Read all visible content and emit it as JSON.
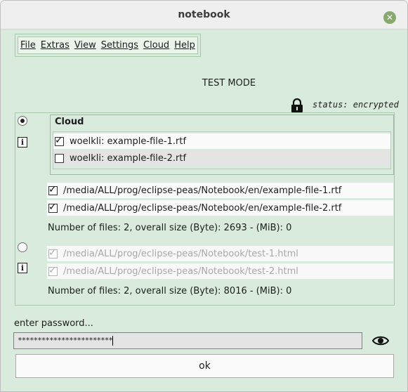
{
  "window": {
    "title": "notebook",
    "close_icon": "close-icon"
  },
  "menu": [
    "File",
    "Extras",
    "View",
    "Settings",
    "Cloud",
    "Help"
  ],
  "mode_label": "TEST MODE",
  "status": {
    "icon": "lock-icon",
    "text": "status: encrypted"
  },
  "cloud": {
    "label": "Cloud",
    "files": [
      {
        "text": "woelkli: example-file-1.rtf",
        "checked": true
      },
      {
        "text": "woelkli: example-file-2.rtf",
        "checked": false
      }
    ]
  },
  "local_files": [
    {
      "text": "/media/ALL/prog/eclipse-peas/Notebook/en/example-file-1.rtf",
      "checked": true
    },
    {
      "text": "/media/ALL/prog/eclipse-peas/Notebook/en/example-file-2.rtf",
      "checked": true
    }
  ],
  "local_summary": "Number of files: 2, overall size (Byte): 2693 - (MiB): 0",
  "html_files": [
    {
      "text": "/media/ALL/prog/eclipse-peas/Notebook/test-1.html",
      "checked": true,
      "disabled": true
    },
    {
      "text": "/media/ALL/prog/eclipse-peas/Notebook/test-2.html",
      "checked": true,
      "disabled": true
    }
  ],
  "html_summary": "Number of files: 2, overall size (Byte): 8016 - (MiB): 0",
  "password": {
    "label": "enter password...",
    "value": "************************"
  },
  "ok_label": "ok",
  "radio_selected": 0
}
